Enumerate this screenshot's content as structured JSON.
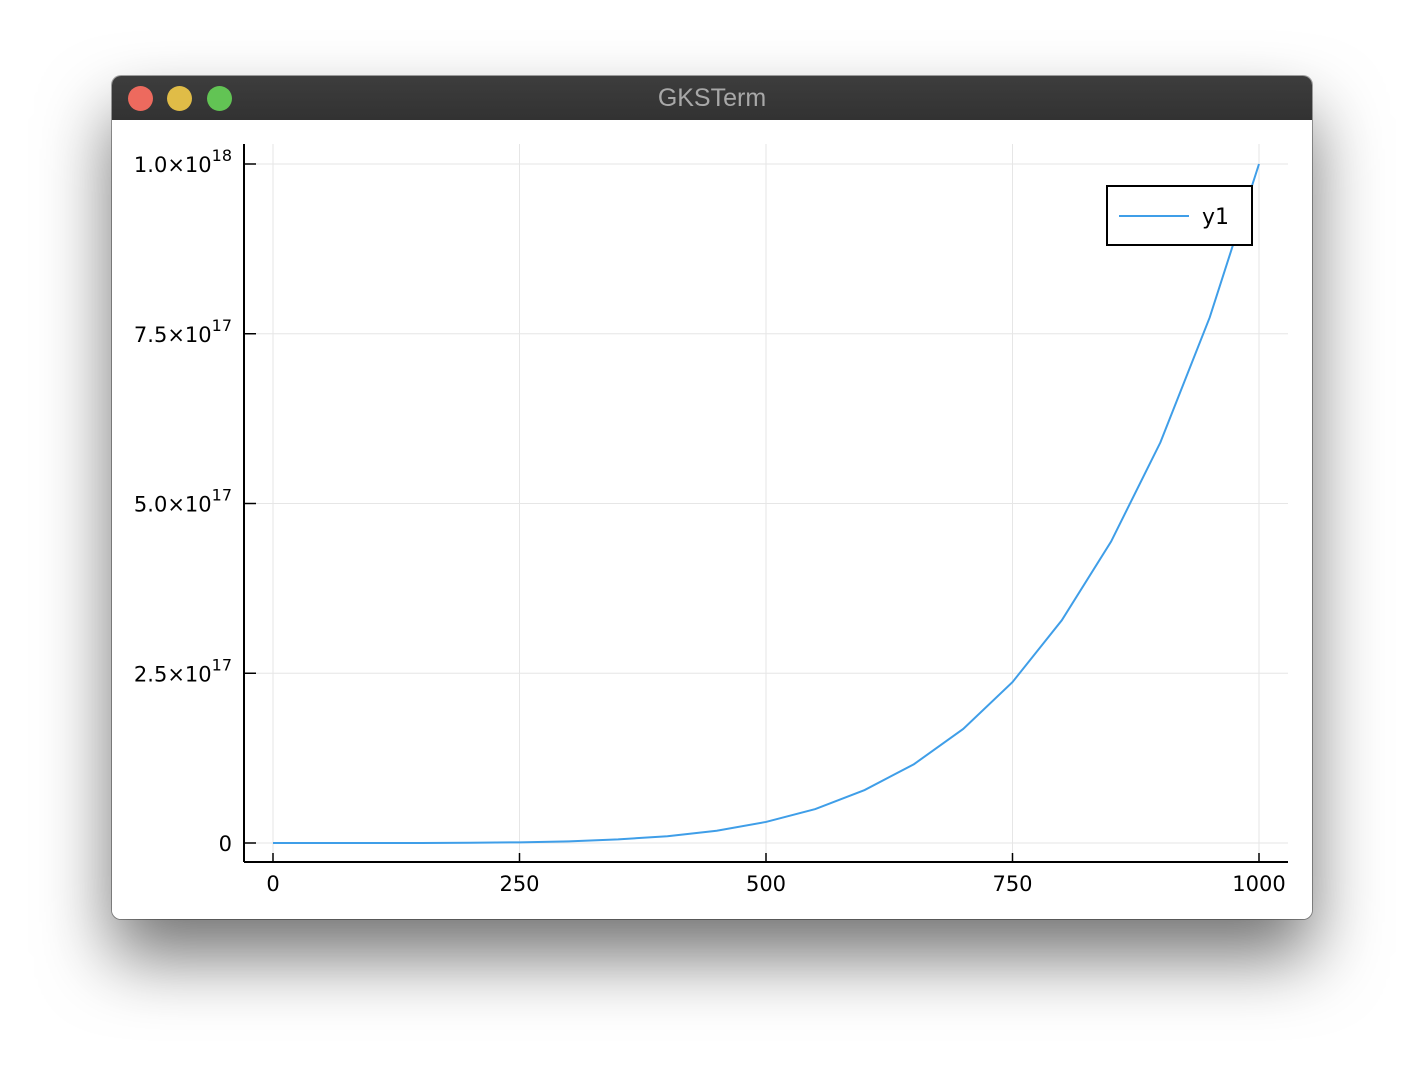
{
  "window": {
    "title": "GKSTerm",
    "buttons": {
      "close_color": "#ed6a5e",
      "minimize_color": "#e0bc47",
      "zoom_color": "#62c454"
    }
  },
  "chart_data": {
    "type": "line",
    "title": "",
    "xlabel": "",
    "ylabel": "",
    "xlim": [
      0,
      1000
    ],
    "ylim": [
      0,
      1e+18
    ],
    "grid": true,
    "legend_position": "top-right",
    "x_ticks": [
      {
        "value": 0,
        "label": "0"
      },
      {
        "value": 250,
        "label": "250"
      },
      {
        "value": 500,
        "label": "500"
      },
      {
        "value": 750,
        "label": "750"
      },
      {
        "value": 1000,
        "label": "1000"
      }
    ],
    "y_ticks": [
      {
        "value": 0,
        "mantissa": "0",
        "exponent": ""
      },
      {
        "value": 2.5e+17,
        "mantissa": "2.5×10",
        "exponent": "17"
      },
      {
        "value": 5e+17,
        "mantissa": "5.0×10",
        "exponent": "17"
      },
      {
        "value": 7.5e+17,
        "mantissa": "7.5×10",
        "exponent": "17"
      },
      {
        "value": 1e+18,
        "mantissa": "1.0×10",
        "exponent": "18"
      }
    ],
    "series": [
      {
        "name": "y1",
        "color": "#3f9ee8",
        "x": [
          0,
          50,
          100,
          150,
          200,
          250,
          300,
          350,
          400,
          450,
          500,
          550,
          600,
          650,
          700,
          750,
          800,
          850,
          900,
          950,
          1000
        ],
        "y": [
          0,
          310000000000.0,
          10000000000000.0,
          76000000000000.0,
          320000000000000.0,
          980000000000000.0,
          2400000000000000.0,
          5300000000000000.0,
          1e+16,
          1.8e+16,
          3.1e+16,
          5e+16,
          7.8e+16,
          1.16e+17,
          1.68e+17,
          2.37e+17,
          3.28e+17,
          4.44e+17,
          5.9e+17,
          7.74e+17,
          1e+18
        ]
      }
    ]
  }
}
